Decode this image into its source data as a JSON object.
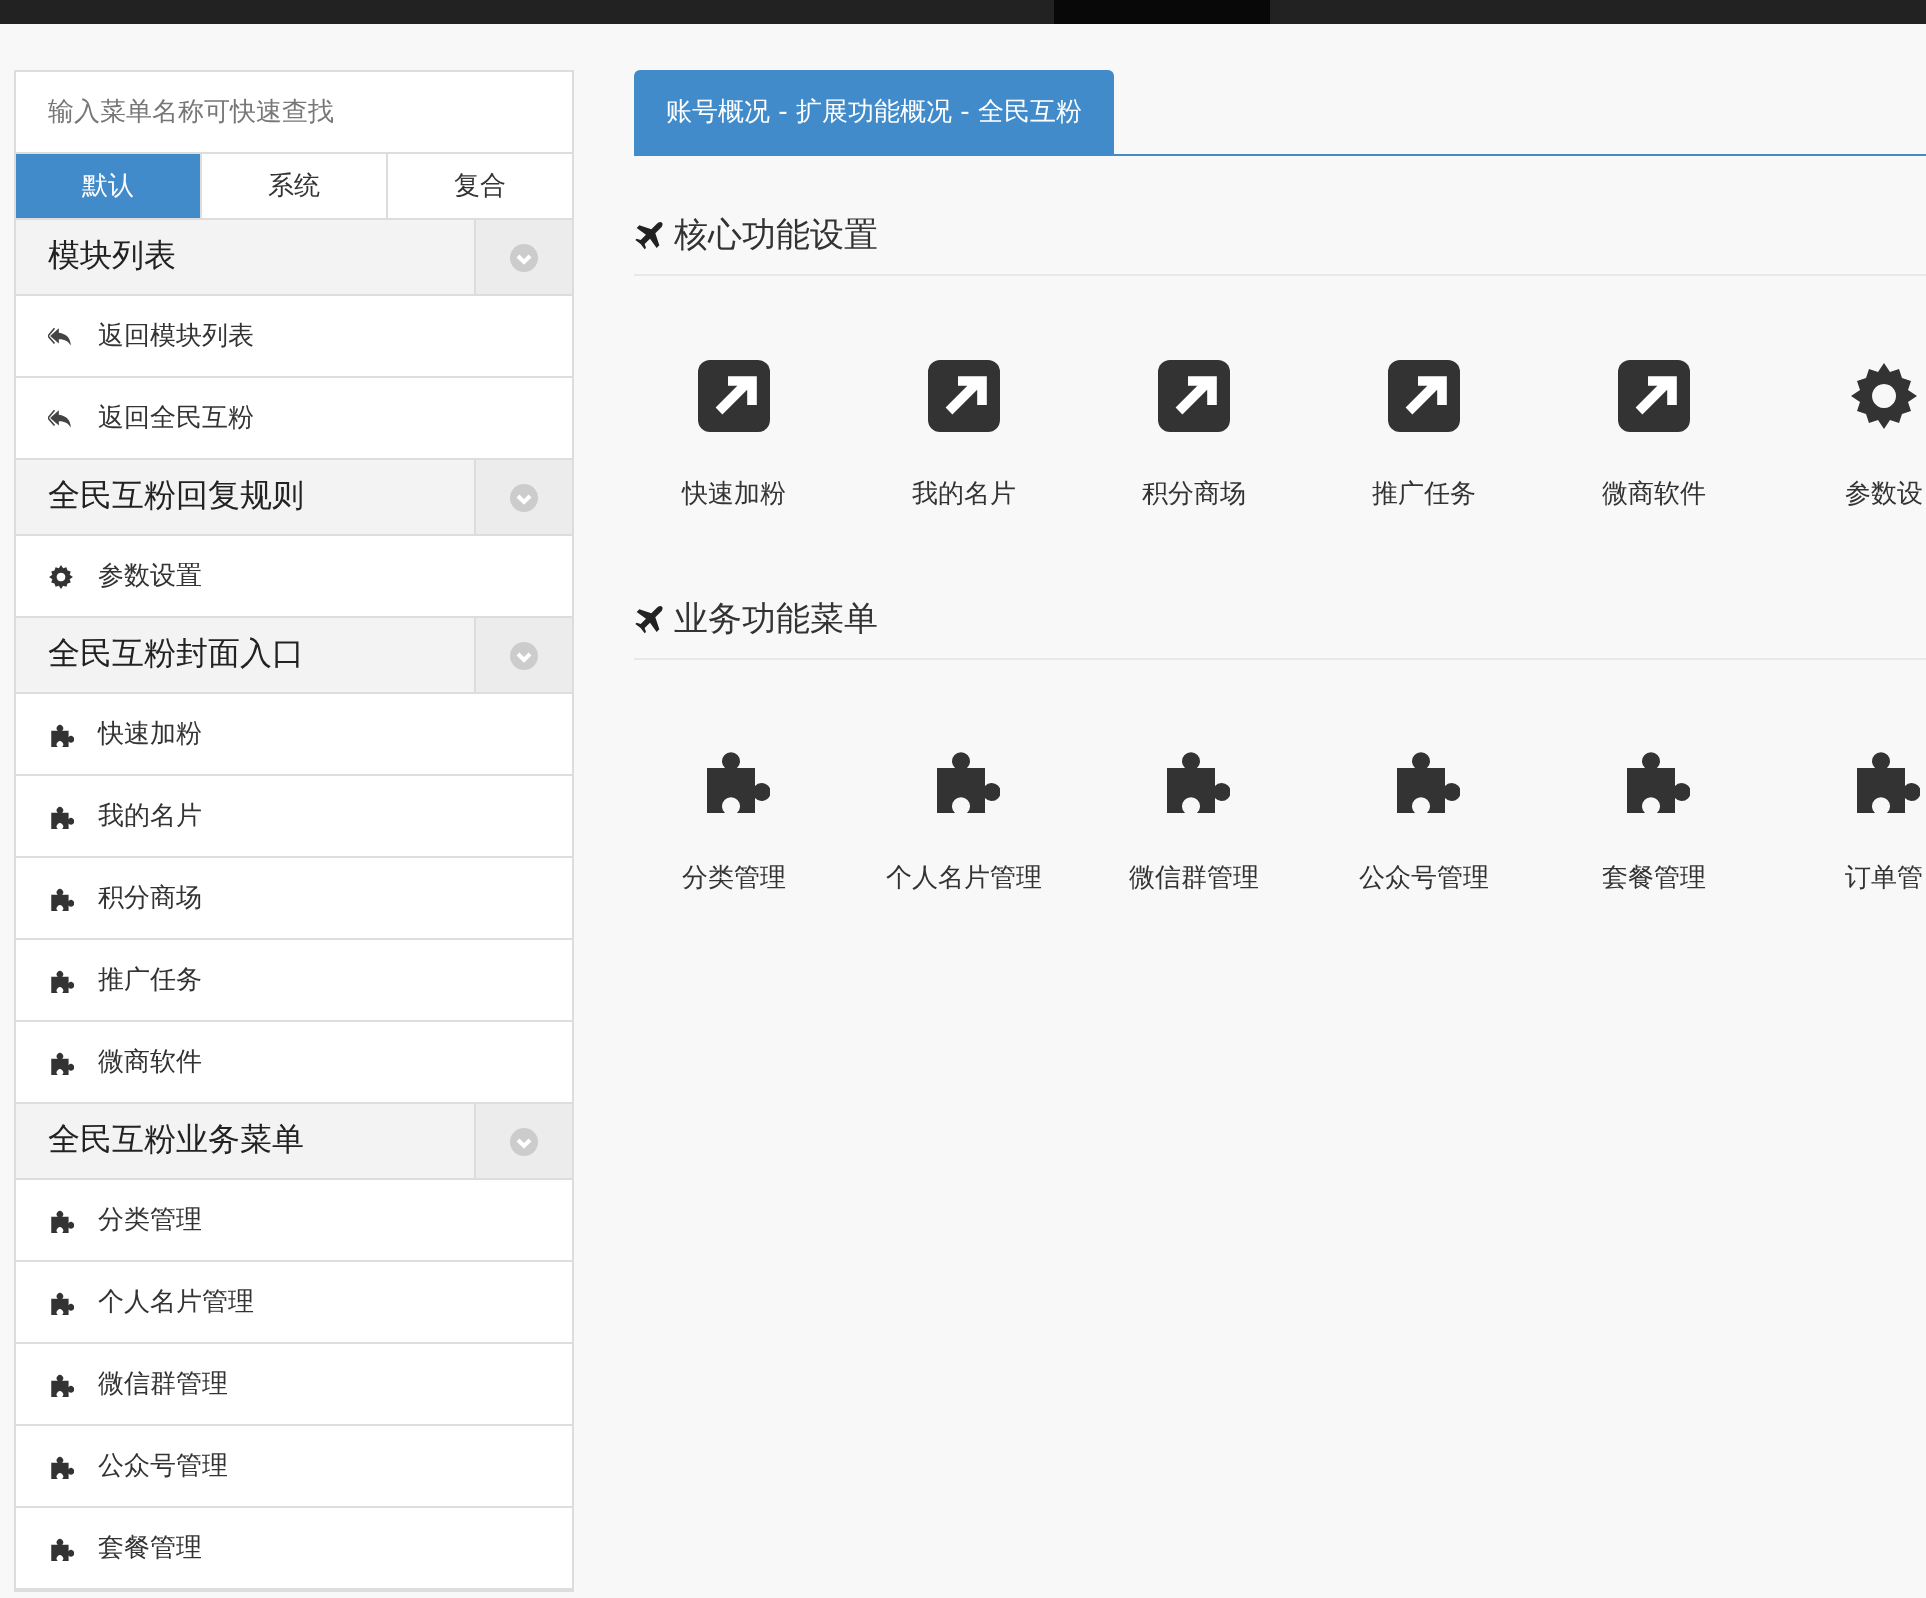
{
  "sidebar": {
    "search": {
      "placeholder": "输入菜单名称可快速查找"
    },
    "tabs": [
      {
        "label": "默认",
        "selected": true
      },
      {
        "label": "系统",
        "selected": false
      },
      {
        "label": "复合",
        "selected": false
      }
    ],
    "groups": [
      {
        "title": "模块列表",
        "items": [
          {
            "label": "返回模块列表",
            "kind": "reply"
          },
          {
            "label": "返回全民互粉",
            "kind": "reply"
          }
        ]
      },
      {
        "title": "全民互粉回复规则",
        "items": [
          {
            "label": "参数设置",
            "kind": "gear"
          }
        ]
      },
      {
        "title": "全民互粉封面入口",
        "items": [
          {
            "label": "快速加粉",
            "kind": "puzzle"
          },
          {
            "label": "我的名片",
            "kind": "puzzle"
          },
          {
            "label": "积分商场",
            "kind": "puzzle"
          },
          {
            "label": "推广任务",
            "kind": "puzzle"
          },
          {
            "label": "微商软件",
            "kind": "puzzle"
          }
        ]
      },
      {
        "title": "全民互粉业务菜单",
        "items": [
          {
            "label": "分类管理",
            "kind": "puzzle"
          },
          {
            "label": "个人名片管理",
            "kind": "puzzle"
          },
          {
            "label": "微信群管理",
            "kind": "puzzle"
          },
          {
            "label": "公众号管理",
            "kind": "puzzle"
          },
          {
            "label": "套餐管理",
            "kind": "puzzle"
          }
        ]
      }
    ]
  },
  "main": {
    "tab": "账号概况 - 扩展功能概况 - 全民互粉",
    "sections": [
      {
        "title": "核心功能设置",
        "items": [
          {
            "label": "快速加粉",
            "kind": "link"
          },
          {
            "label": "我的名片",
            "kind": "link"
          },
          {
            "label": "积分商场",
            "kind": "link"
          },
          {
            "label": "推广任务",
            "kind": "link"
          },
          {
            "label": "微商软件",
            "kind": "link"
          },
          {
            "label": "参数设",
            "kind": "gear"
          }
        ]
      },
      {
        "title": "业务功能菜单",
        "items": [
          {
            "label": "分类管理",
            "kind": "puzzle"
          },
          {
            "label": "个人名片管理",
            "kind": "puzzle"
          },
          {
            "label": "微信群管理",
            "kind": "puzzle"
          },
          {
            "label": "公众号管理",
            "kind": "puzzle"
          },
          {
            "label": "套餐管理",
            "kind": "puzzle"
          },
          {
            "label": "订单管",
            "kind": "puzzle"
          }
        ]
      }
    ]
  }
}
